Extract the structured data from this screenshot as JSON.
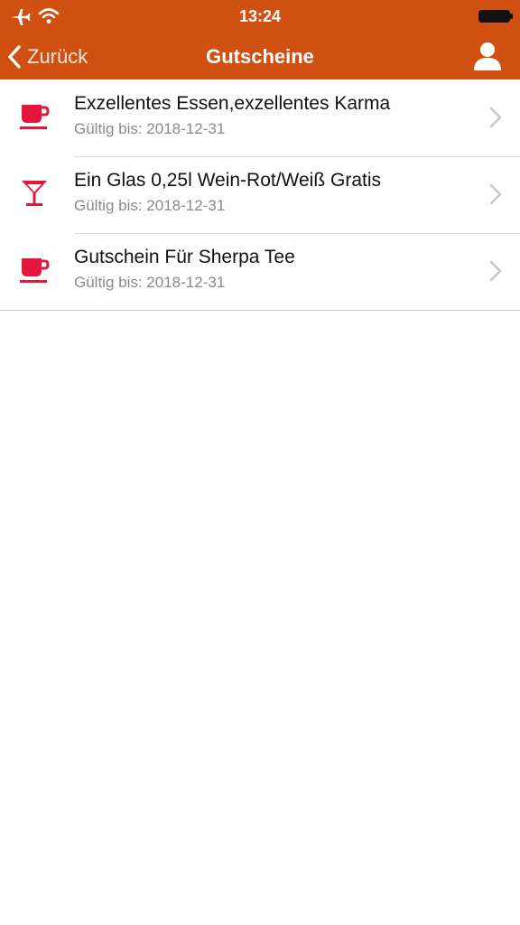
{
  "status_bar": {
    "time": "13:24",
    "icons": [
      "airplane-icon",
      "wifi-icon",
      "battery-icon"
    ]
  },
  "nav": {
    "back_label": "Zurück",
    "title": "Gutscheine",
    "profile_icon": "person-icon"
  },
  "colors": {
    "accent": "#d05012",
    "icon_red": "#e3173e",
    "subtitle": "#8a8a8a"
  },
  "vouchers": [
    {
      "icon": "coffee-cup-icon",
      "title": "Exzellentes Essen,exzellentes Karma",
      "valid": "Gültig bis: 2018-12-31"
    },
    {
      "icon": "cocktail-glass-icon",
      "title": "Ein Glas 0,25l Wein-Rot/Weiß Gratis",
      "valid": "Gültig bis: 2018-12-31"
    },
    {
      "icon": "coffee-cup-icon",
      "title": "Gutschein Für Sherpa Tee",
      "valid": "Gültig bis: 2018-12-31"
    }
  ]
}
